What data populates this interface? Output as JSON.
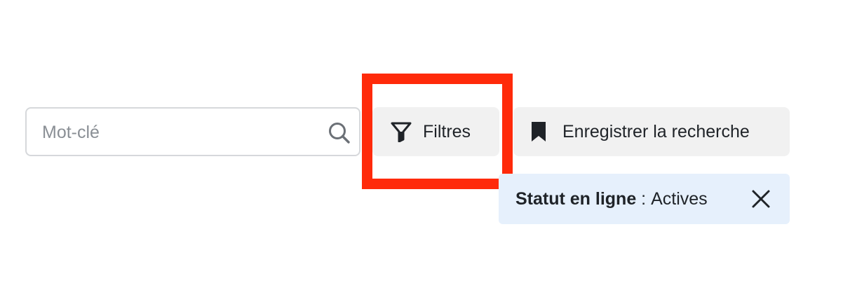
{
  "search": {
    "placeholder": "Mot-clé",
    "value": "",
    "icon": "search-icon"
  },
  "toolbar": {
    "filters_label": "Filtres",
    "filters_icon": "filter-icon",
    "save_search_label": "Enregistrer la recherche",
    "save_search_icon": "bookmark-icon"
  },
  "active_filters": [
    {
      "label": "Statut en ligne",
      "separator": " : ",
      "value": "Actives",
      "remove_icon": "close-icon"
    }
  ],
  "colors": {
    "highlight": "#ff2a0a",
    "button_bg": "#f1f1f1",
    "chip_bg": "#e6f0fc",
    "text": "#1f2328",
    "placeholder": "#8a8f95"
  }
}
